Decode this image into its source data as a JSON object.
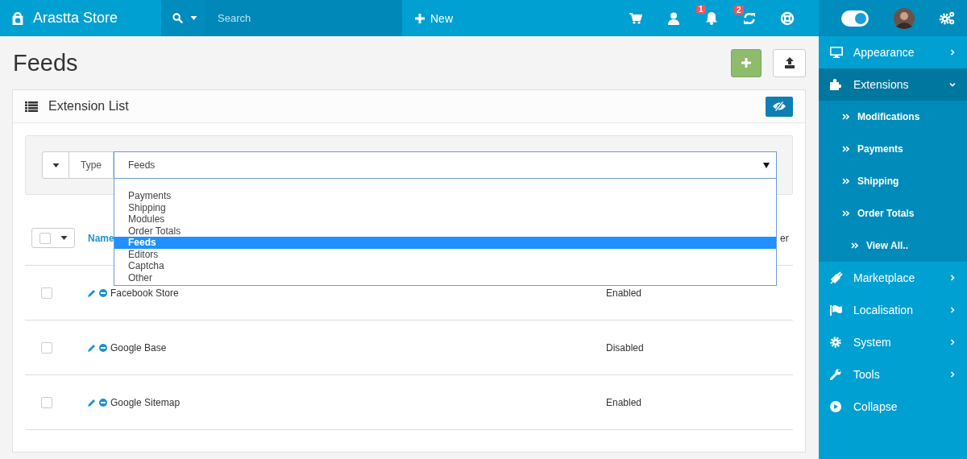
{
  "header": {
    "brand": "Arastta Store",
    "search": {
      "placeholder": "Search"
    },
    "new_button": "New",
    "icons": [
      {
        "kind": "cart"
      },
      {
        "kind": "user"
      },
      {
        "kind": "bell",
        "badge": "1"
      },
      {
        "kind": "refresh",
        "badge": "2"
      },
      {
        "kind": "lifebuoy"
      }
    ],
    "toggle": {
      "on": true
    }
  },
  "page": {
    "title": "Feeds"
  },
  "panel": {
    "title": "Extension List"
  },
  "filter": {
    "label": "Type",
    "value": "Feeds",
    "options": [
      {
        "label": "Payments",
        "selected": false
      },
      {
        "label": "Shipping",
        "selected": false
      },
      {
        "label": "Modules",
        "selected": false
      },
      {
        "label": "Order Totals",
        "selected": false
      },
      {
        "label": "Feeds",
        "selected": true
      },
      {
        "label": "Editors",
        "selected": false
      },
      {
        "label": "Captcha",
        "selected": false
      },
      {
        "label": "Other",
        "selected": false
      }
    ]
  },
  "table": {
    "columns": [
      "Name",
      "er"
    ],
    "rows": [
      {
        "name": "Facebook Store",
        "status": "Enabled",
        "checked": false
      },
      {
        "name": "Google Base",
        "status": "Disabled",
        "checked": false
      },
      {
        "name": "Google Sitemap",
        "status": "Enabled",
        "checked": false
      }
    ]
  },
  "sidebar": {
    "items": [
      {
        "kind": "menu",
        "label": "Appearance",
        "expanded": false
      },
      {
        "kind": "menu",
        "label": "Extensions",
        "expanded": true,
        "children": [
          {
            "label": "Modifications",
            "kind": "link"
          },
          {
            "label": "Payments",
            "kind": "link"
          },
          {
            "label": "Shipping",
            "kind": "link"
          },
          {
            "label": "Order Totals",
            "kind": "link"
          },
          {
            "label": "View All..",
            "kind": "more"
          }
        ]
      },
      {
        "kind": "menu",
        "label": "Marketplace",
        "expanded": false
      },
      {
        "kind": "menu",
        "label": "Localisation",
        "expanded": false
      },
      {
        "kind": "menu",
        "label": "System",
        "expanded": false
      },
      {
        "kind": "menu",
        "label": "Tools",
        "expanded": false
      },
      {
        "kind": "action",
        "label": "Collapse",
        "expanded": false
      }
    ]
  }
}
